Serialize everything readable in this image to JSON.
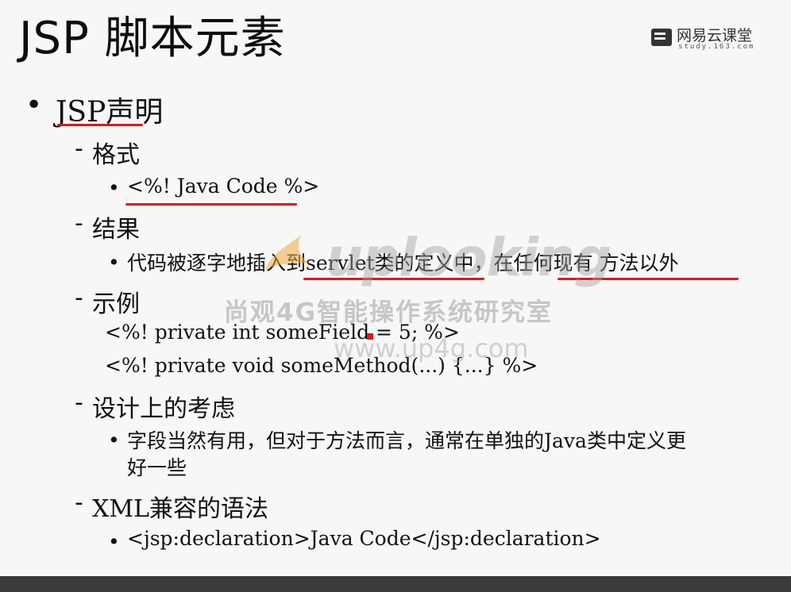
{
  "title": "JSP 脚本元素",
  "logo": {
    "name": "网易云课堂",
    "url": "study.163.com"
  },
  "items": {
    "l1_declaration": "JSP声明",
    "format_heading": "格式",
    "format_code": "<%! Java Code %>",
    "result_heading": "结果",
    "result_text": "代码被逐字地插入到servlet类的定义中，在任何现有 方法以外",
    "example_heading": "示例",
    "example_line1": "<%! private int someField = 5; %>",
    "example_line2": "<%! private void someMethod(...) {...} %>",
    "design_heading": "设计上的考虑",
    "design_text_line1": "字段当然有用，但对于方法而言，通常在单独的Java类中定义更",
    "design_text_line2": "好一些",
    "xml_heading": "XML兼容的语法",
    "xml_code": "<jsp:declaration>Java Code</jsp:declaration>"
  },
  "bullets": {
    "main": "•",
    "sub": "-",
    "small": "•"
  },
  "watermark": {
    "brand": "uplooking",
    "cn_text": "尚观4G智能操作系统研究室",
    "url": "www.up4g.com"
  },
  "colors": {
    "underline": "#e01818",
    "background": "#f7f7f7",
    "bottom_bar": "#3a3a3a"
  }
}
